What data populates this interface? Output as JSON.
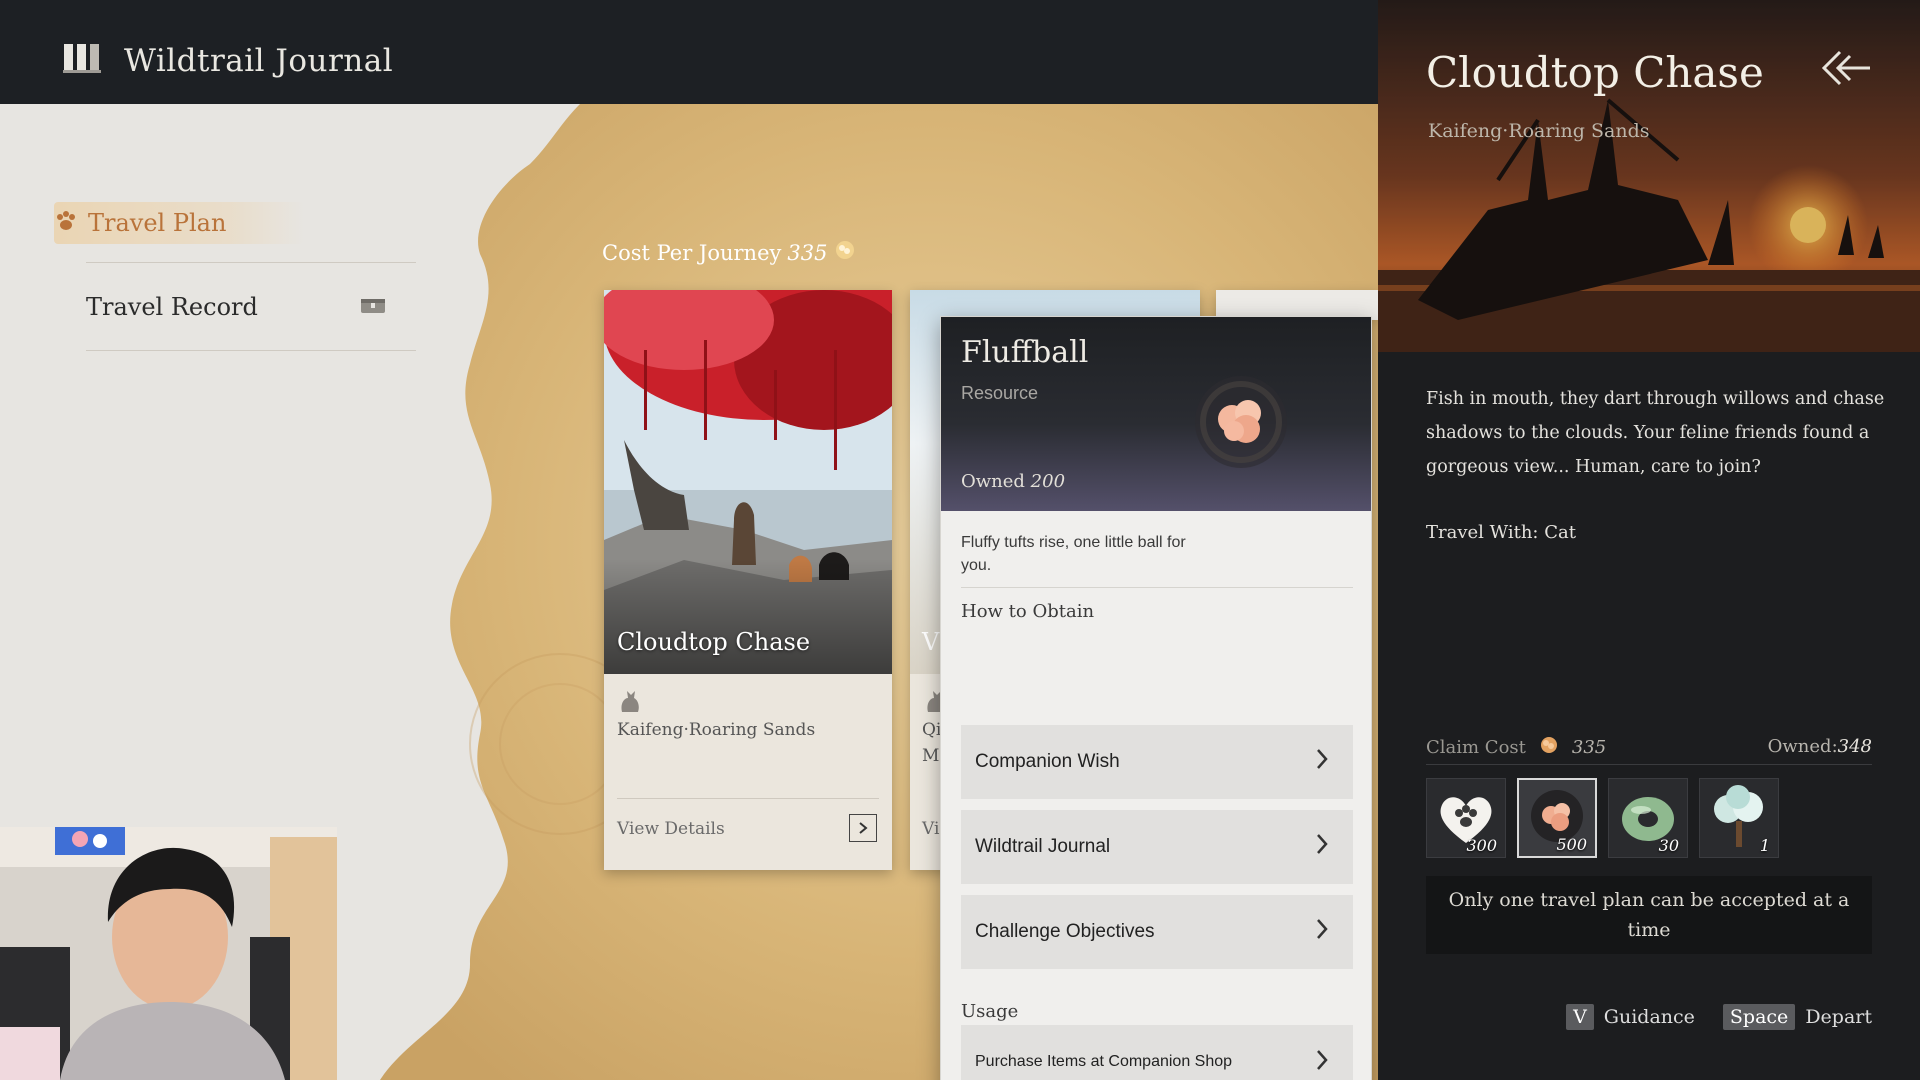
{
  "header": {
    "title": "Wildtrail Journal",
    "icon": "journal-book-icon"
  },
  "nav": {
    "items": [
      {
        "label": "Travel Plan",
        "icon": "paw-icon",
        "active": true
      },
      {
        "label": "Travel Record",
        "icon": "chest-icon",
        "active": false
      }
    ]
  },
  "journey": {
    "cost_label": "Cost Per Journey",
    "cost_value": "335",
    "currency_icon": "fluff-coin-icon"
  },
  "cards": [
    {
      "title": "Cloudtop Chase",
      "location": "Kaifeng·Roaring Sands",
      "action": "View Details",
      "icon": "cat-icon"
    },
    {
      "title": "V",
      "location_line1": "Qi",
      "location_line2": "M",
      "action": "Vi",
      "icon": "cat-icon"
    }
  ],
  "tooltip": {
    "name": "Fluffball",
    "type": "Resource",
    "owned_label": "Owned",
    "owned_value": "200",
    "description": "Fluffy tufts rise, one little ball for you.",
    "obtain_label": "How to Obtain",
    "obtain": [
      "Companion Wish",
      "Wildtrail Journal",
      "Challenge Objectives"
    ],
    "usage_label": "Usage",
    "usage": [
      "Purchase Items at Companion Shop"
    ]
  },
  "detail": {
    "title": "Cloudtop Chase",
    "subtitle": "Kaifeng·Roaring Sands",
    "description": "Fish in mouth, they dart through willows and chase shadows to the clouds. Your feline friends found a gorgeous view... Human, care to join?",
    "travel_with": "Travel With: Cat",
    "claim_label": "Claim Cost",
    "claim_value": "335",
    "owned_label": "Owned:",
    "owned_value": "348",
    "resources": [
      {
        "icon": "paw-heart-icon",
        "count": "300"
      },
      {
        "icon": "fluffball-icon",
        "count": "500",
        "selected": true
      },
      {
        "icon": "jade-ring-icon",
        "count": "30"
      },
      {
        "icon": "blossom-tree-icon",
        "count": "1"
      }
    ],
    "notice": "Only one travel plan can be accepted at a time",
    "keys": [
      {
        "key": "V",
        "label": "Guidance"
      },
      {
        "key": "Space",
        "label": "Depart"
      }
    ]
  },
  "colors": {
    "accent": "#b9733a",
    "panel": "#1c1d1f",
    "parchment": "#d9b77c"
  }
}
